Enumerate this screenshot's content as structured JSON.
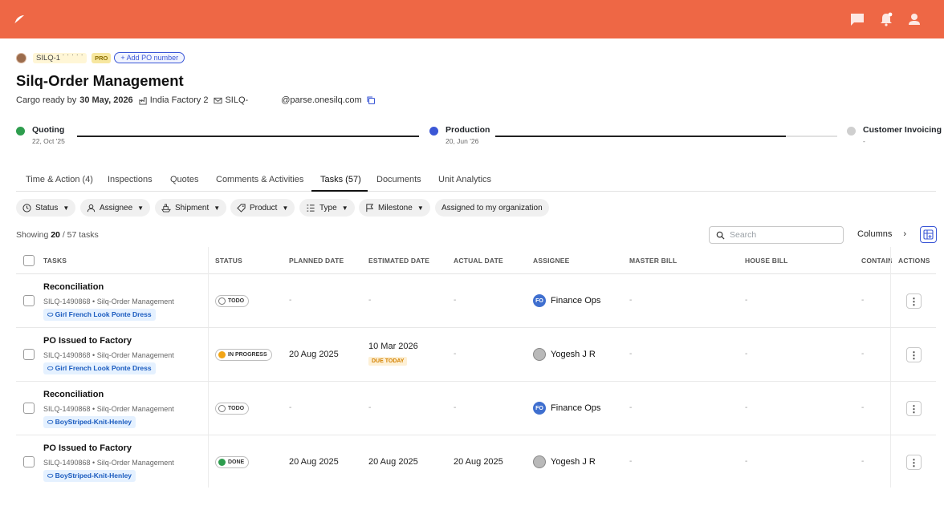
{
  "header": {
    "logo_icon": "feather-icon",
    "icons": [
      "chat-icon",
      "notification-bell-icon",
      "user-icon"
    ],
    "brand_color": "#ee6745"
  },
  "order": {
    "code": "SILQ-1 ˙ ˙ ˙ ˙ ˙",
    "badge": "PRO",
    "add_po_label": "+ Add PO number",
    "title": "Silq-Order Management",
    "cargo_ready_prefix": "Cargo ready by",
    "cargo_ready_date": "30 May, 2026",
    "factory": "India Factory 2",
    "email_prefix": "SILQ-",
    "email_domain": "@parse.onesilq.com"
  },
  "milestones": [
    {
      "label": "Quoting",
      "date": "22, Oct '25",
      "state": "done"
    },
    {
      "label": "Production",
      "date": "20, Jun '26",
      "state": "current"
    },
    {
      "label": "Customer Invoicing",
      "date": "-",
      "state": "pending"
    }
  ],
  "milestone_progress": [
    1.0,
    0.85
  ],
  "tabs": [
    {
      "label": "Time & Action (4)"
    },
    {
      "label": "Inspections"
    },
    {
      "label": "Quotes"
    },
    {
      "label": "Comments & Activities"
    },
    {
      "label": "Tasks (57)",
      "active": true
    },
    {
      "label": "Documents"
    },
    {
      "label": "Unit Analytics"
    }
  ],
  "filters": [
    {
      "label": "Status",
      "icon": "clock-icon"
    },
    {
      "label": "Assignee",
      "icon": "person-icon"
    },
    {
      "label": "Shipment",
      "icon": "ship-icon"
    },
    {
      "label": "Product",
      "icon": "tag-icon"
    },
    {
      "label": "Type",
      "icon": "list-icon"
    },
    {
      "label": "Milestone",
      "icon": "flag-icon"
    },
    {
      "label": "Assigned to my organization"
    }
  ],
  "toolbar": {
    "showing_prefix": "Showing",
    "showing_count": "20",
    "showing_suffix": "/ 57 tasks",
    "search_placeholder": "Search",
    "columns_label": "Columns"
  },
  "table": {
    "columns": [
      "TASKS",
      "STATUS",
      "PLANNED DATE",
      "ESTIMATED DATE",
      "ACTUAL DATE",
      "ASSIGNEE",
      "MASTER BILL",
      "HOUSE BILL",
      "CONTAIN",
      "ACTIONS"
    ],
    "rows": [
      {
        "title": "Reconciliation",
        "sub": "SILQ-1490868 • Silq-Order Management",
        "tag": "Girl French Look Ponte Dress",
        "status": "TODO",
        "planned": "-",
        "estimated": "-",
        "due": "",
        "actual": "-",
        "assignee": "Finance Ops",
        "initials": "FO",
        "master": "-",
        "house": "-",
        "contain": "-"
      },
      {
        "title": "PO Issued to Factory",
        "sub": "SILQ-1490868 • Silq-Order Management",
        "tag": "Girl French Look Ponte Dress",
        "status": "IN PROGRESS",
        "planned": "20 Aug 2025",
        "estimated": "10 Mar 2026",
        "due": "DUE TODAY",
        "actual": "-",
        "assignee": "Yogesh J R",
        "initials": "",
        "master": "-",
        "house": "-",
        "contain": "-"
      },
      {
        "title": "Reconciliation",
        "sub": "SILQ-1490868 • Silq-Order Management",
        "tag": "BoyStriped-Knit-Henley",
        "status": "TODO",
        "planned": "-",
        "estimated": "-",
        "due": "",
        "actual": "-",
        "assignee": "Finance Ops",
        "initials": "FO",
        "master": "-",
        "house": "-",
        "contain": "-"
      },
      {
        "title": "PO Issued to Factory",
        "sub": "SILQ-1490868 • Silq-Order Management",
        "tag": "BoyStriped-Knit-Henley",
        "status": "DONE",
        "planned": "20 Aug 2025",
        "estimated": "20 Aug 2025",
        "due": "",
        "actual": "20 Aug 2025",
        "assignee": "Yogesh J R",
        "initials": "",
        "master": "-",
        "house": "-",
        "contain": "-"
      }
    ]
  },
  "colors": {
    "done": "#2e9d4e",
    "current": "#3b57d6",
    "pending": "#cfcfcf",
    "in_progress": "#f2a516"
  }
}
